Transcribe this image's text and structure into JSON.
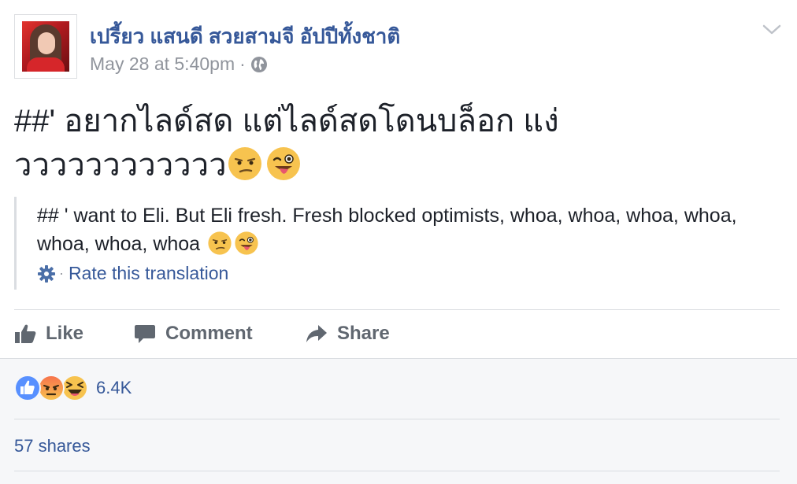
{
  "post": {
    "author": "เปรี้ยว แสนดี สวยสามจี อัปปีทั้งชาติ",
    "timestamp": "May 28 at 5:40pm",
    "separator": "·",
    "privacy_icon": "globe-icon",
    "menu_icon": "chevron-down-icon",
    "text_line1": "##' อยากไลด์สด แต่ไลด์สดโดนบล็อก แง่",
    "text_line2": "วววววววววววว",
    "text_emojis": [
      "unamused-face",
      "winking-tongue-face"
    ]
  },
  "translation": {
    "text": "## ' want to Eli. But Eli fresh. Fresh blocked optimists, whoa, whoa, whoa, whoa, whoa, whoa, whoa",
    "emojis": [
      "unamused-face",
      "winking-tongue-face"
    ],
    "rate_label": "Rate this translation",
    "rate_icon": "gear-icon",
    "separator": "·"
  },
  "actions": {
    "like_label": "Like",
    "comment_label": "Comment",
    "share_label": "Share"
  },
  "reactions": {
    "icons": [
      "like-reaction-icon",
      "angry-reaction-icon",
      "haha-reaction-icon"
    ],
    "count": "6.4K"
  },
  "shares": {
    "label": "57 shares"
  },
  "colors": {
    "link": "#365899",
    "text": "#1d2129",
    "muted": "#90949c",
    "action": "#606770",
    "like_blue": "#5890ff",
    "angry_orange": "#f7714c",
    "haha_yellow": "#f7c34f"
  }
}
